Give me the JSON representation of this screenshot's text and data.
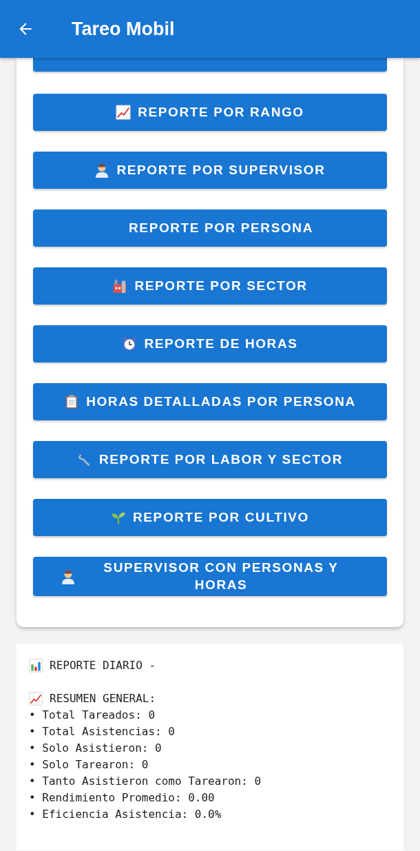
{
  "app_bar": {
    "title": "Tareo Mobil"
  },
  "report_buttons": [
    {
      "kind": "hidden"
    },
    {
      "kind": "chart",
      "label": "REPORTE POR RANGO"
    },
    {
      "kind": "person",
      "label": "REPORTE POR SUPERVISOR"
    },
    {
      "kind": "none",
      "label": "REPORTE POR PERSONA"
    },
    {
      "kind": "factory",
      "label": "REPORTE POR SECTOR"
    },
    {
      "kind": "clock",
      "label": "REPORTE DE HORAS"
    },
    {
      "kind": "clipboard",
      "label": "HORAS DETALLADAS POR PERSONA"
    },
    {
      "kind": "wrench",
      "label": "REPORTE POR LABOR Y SECTOR"
    },
    {
      "kind": "sprout",
      "label": "REPORTE POR CULTIVO"
    },
    {
      "kind": "person",
      "label": "SUPERVISOR CON PERSONAS Y HORAS"
    }
  ],
  "report": {
    "title": "REPORTE DIARIO -",
    "section": "RESUMEN GENERAL:",
    "lines": [
      "• Total Tareados: 0",
      "• Total Asistencias: 0",
      "• Solo Asistieron: 0",
      "• Solo Tarearon: 0",
      "• Tanto Asistieron como Tarearon: 0",
      "• Rendimiento Promedio: 0.00",
      "• Eficiencia Asistencia: 0.0%"
    ]
  }
}
